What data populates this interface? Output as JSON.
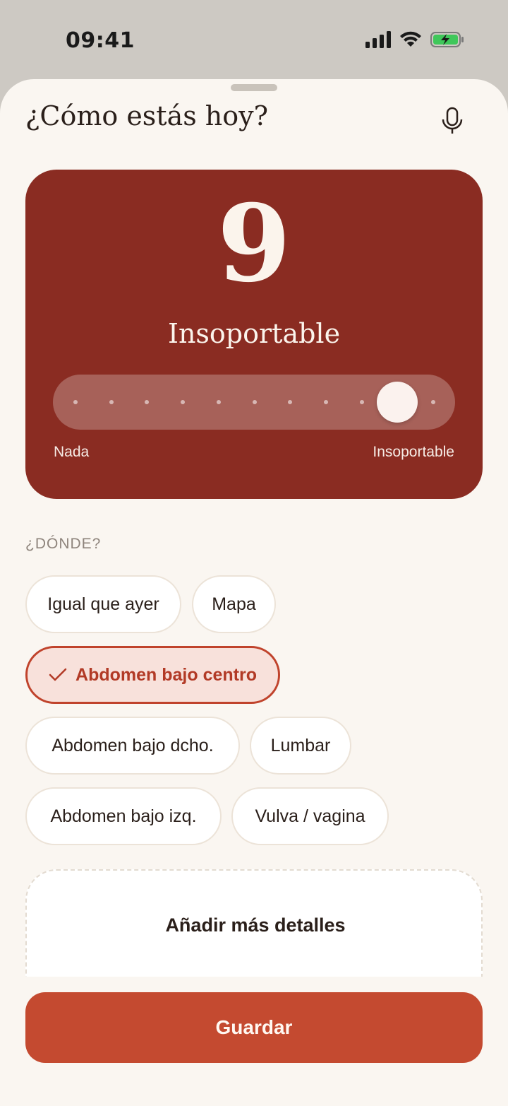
{
  "status_bar": {
    "time": "09:41"
  },
  "header": {
    "title": "¿Cómo estás hoy?",
    "mic_icon": "microphone-icon"
  },
  "pain_card": {
    "value": "9",
    "label": "Insoportable",
    "slider": {
      "min": 0,
      "max": 10,
      "current": 9
    },
    "scale_min_label": "Nada",
    "scale_max_label": "Insoportable",
    "colors": {
      "background": "#8a2c22"
    }
  },
  "location": {
    "section_label": "¿DÓNDE?",
    "chips": [
      {
        "label": "Igual que ayer",
        "selected": false
      },
      {
        "label": "Mapa",
        "selected": false
      },
      {
        "label": "Abdomen bajo centro",
        "selected": true
      },
      {
        "label": "Abdomen bajo dcho.",
        "selected": false
      },
      {
        "label": "Lumbar",
        "selected": false
      },
      {
        "label": "Abdomen bajo izq.",
        "selected": false
      },
      {
        "label": "Vulva / vagina",
        "selected": false
      }
    ]
  },
  "details": {
    "title": "Añadir más detalles"
  },
  "footer": {
    "save_label": "Guardar"
  },
  "colors": {
    "accent": "#c44a30",
    "background": "#faf6f1"
  }
}
